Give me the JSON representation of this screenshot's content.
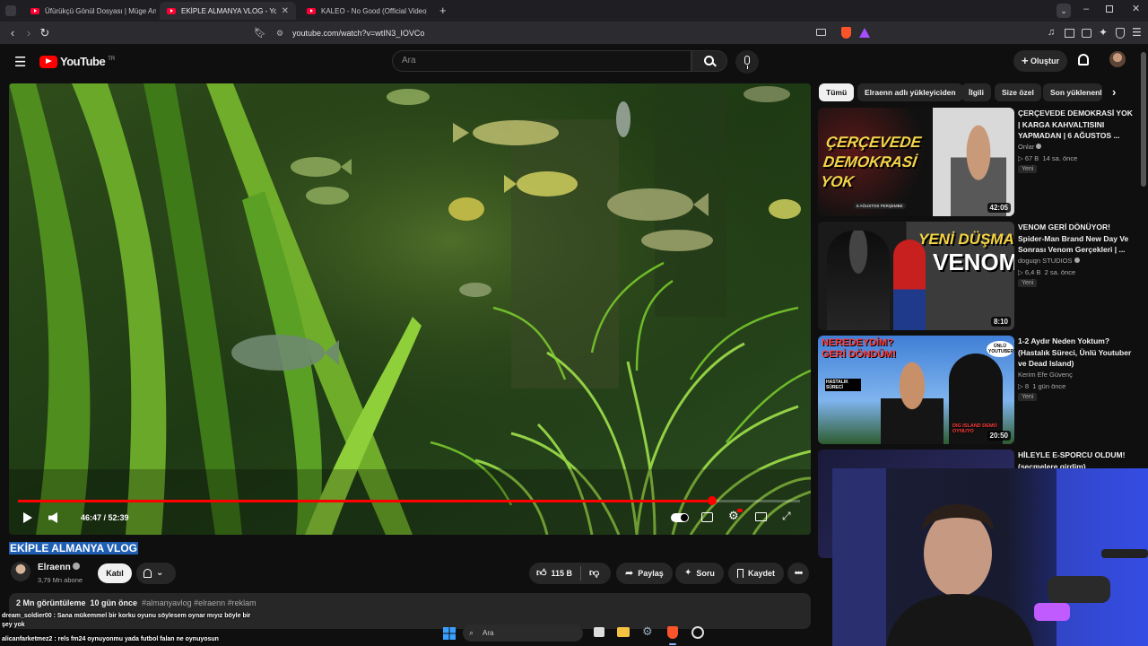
{
  "tabs": [
    {
      "title": "Üfürükçü Gönül Dosyası | Müge Anlı",
      "active": false
    },
    {
      "title": "EKİPLE ALMANYA VLOG - YouTube",
      "active": true
    },
    {
      "title": "KALEO - No Good (Official Video) - YouTube",
      "active": false
    }
  ],
  "address": {
    "url": "youtube.com/watch?v=wtIN3_IOVCo"
  },
  "header": {
    "logo": "YouTube",
    "region": "TR",
    "search_placeholder": "Ara",
    "create_label": "Oluştur"
  },
  "player": {
    "current_time": "46:47",
    "duration": "52:39",
    "progress": 0.888
  },
  "video": {
    "title": "EKİPLE ALMANYA VLOG",
    "channel": "Elraenn",
    "subscribers": "3,79 Mn abone",
    "join_label": "Katıl",
    "likes": "115 B",
    "share_label": "Paylaş",
    "ask_label": "Soru",
    "save_label": "Kaydet",
    "views": "2 Mn görüntüleme",
    "age": "10 gün önce",
    "tags": "#almanyavlog #elraenn #reklam"
  },
  "chips": [
    "Tümü",
    "Elraenn adlı yükleyiciden",
    "İlgili",
    "Size özel",
    "Son yüklenenler"
  ],
  "recommendations": [
    {
      "title": "ÇERÇEVEDE DEMOKRASİ YOK | KARGA KAHVALTISINI YAPMADAN | 6 AĞUSTOS ...",
      "channel": "Onlar",
      "views": "67 B",
      "age": "14 sa. önce",
      "badge": "Yeni",
      "duration": "42:05",
      "thumb_text": "ÇERÇEVEDE DEMOKRASİ YOK",
      "thumb_sub": "6 AĞUSTOS PERŞEMBE"
    },
    {
      "title": "VENOM GERİ DÖNÜYOR! Spider-Man Brand New Day Ve Sonrası Venom Gerçekleri | ...",
      "channel": "doguqn STUDIOS",
      "views": "6,4 B",
      "age": "2 sa. önce",
      "badge": "Yeni",
      "duration": "8:10",
      "thumb_text": "YENİ DÜŞMAN",
      "thumb_text2": "VENOM"
    },
    {
      "title": "1-2 Aydır Neden Yoktum? (Hastalık Süreci, Ünlü Youtuber ve Dead Island)",
      "channel": "Kerim Efe Güvenç",
      "views": "8",
      "age": "1 gün önce",
      "badge": "Yeni",
      "duration": "20:50",
      "thumb_text": "NEREDEYDİM? GERİ DÖNDÜM!",
      "thumb_sub": "HASTALIK SÜRECİ",
      "thumb_side": "ÜNLÜ YOUTUBER?",
      "thumb_corner": "DIG ISLAND DEMO OYNUYO"
    },
    {
      "title": "HİLEYLE E-SPORCU OLDUM! (seçmelere girdim)",
      "channel": "",
      "views": "",
      "age": "",
      "badge": "",
      "duration": ""
    }
  ],
  "chat": [
    {
      "user": "dream_soldier00",
      "message": "Sana mükemmel bir korku oyunu söylesem oynar mıyız böyle bir şey yok"
    },
    {
      "user": "alicanfarketmez2",
      "message": "rels fm24 oynuyonmu yada futbol falan ne oynuyosun"
    }
  ],
  "taskbar": {
    "search_placeholder": "Ara"
  },
  "colors": {
    "accent": "#ff0000",
    "background": "#0f0f0f",
    "chip_selected": "#f1f1f1",
    "title_highlight": "#1e5fb4"
  }
}
